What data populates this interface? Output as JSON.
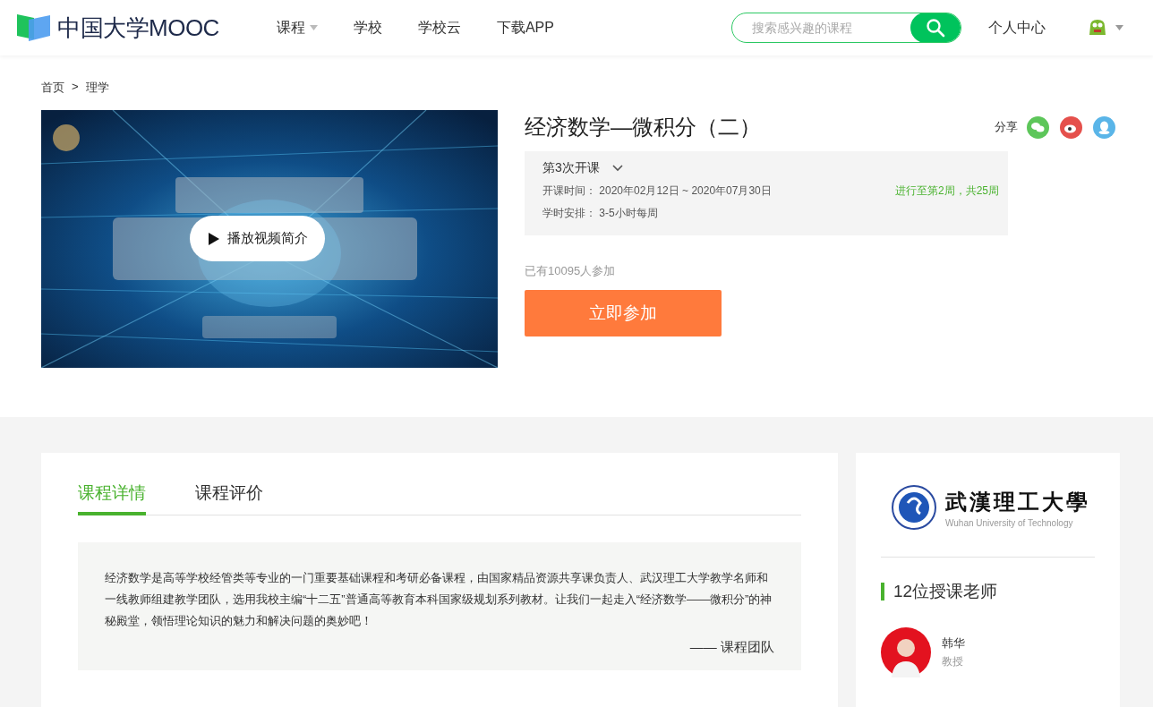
{
  "header": {
    "logo_text": "中国大学MOOC",
    "nav": [
      {
        "label": "课程",
        "dropdown": true
      },
      {
        "label": "学校",
        "dropdown": false
      },
      {
        "label": "学校云",
        "dropdown": false
      },
      {
        "label": "下载APP",
        "dropdown": false
      }
    ],
    "search": {
      "placeholder": "搜索感兴趣的课程"
    },
    "user_center": "个人中心"
  },
  "breadcrumb": {
    "items": [
      "首页",
      "理学"
    ],
    "separator": ">"
  },
  "course": {
    "video": {
      "kind": "picture",
      "play_label": "播放视频简介"
    },
    "title": "经济数学—微积分（二）",
    "share_label": "分享",
    "share": [
      {
        "kind": "wechat"
      },
      {
        "kind": "weibo"
      },
      {
        "kind": "qq"
      }
    ],
    "session": {
      "label": "第3次开课",
      "time_label": "开课时间：",
      "time_value": "2020年02月12日 ~ 2020年07月30日",
      "progress": "进行至第2周，共25周",
      "ongoing": true,
      "hours_label": "学时安排：",
      "hours_value": "3-5小时每周"
    },
    "enrolled": "已有10095人参加",
    "join_button": "立即参加"
  },
  "tabs": [
    {
      "label": "课程详情",
      "selected": true
    },
    {
      "label": "课程评价",
      "selected": false
    }
  ],
  "description": {
    "text": "经济数学是高等学校经管类等专业的一门重要基础课程和考研必备课程，由国家精品资源共享课负责人、武汉理工大学教学名师和一线教师组建教学团队，选用我校主编“十二五”普通高等教育本科国家级规划系列教材。让我们一起走入“经济数学——微积分”的神秘殿堂，领悟理论知识的魅力和解决问题的奥妙吧！",
    "signature": "—— 课程团队"
  },
  "school": {
    "name_cn": "武漢理工大學",
    "name_en": "Wuhan University of Technology"
  },
  "teachers": {
    "heading": "12位授课老师",
    "list": [
      {
        "name": "韩华",
        "title": "教授"
      }
    ]
  }
}
